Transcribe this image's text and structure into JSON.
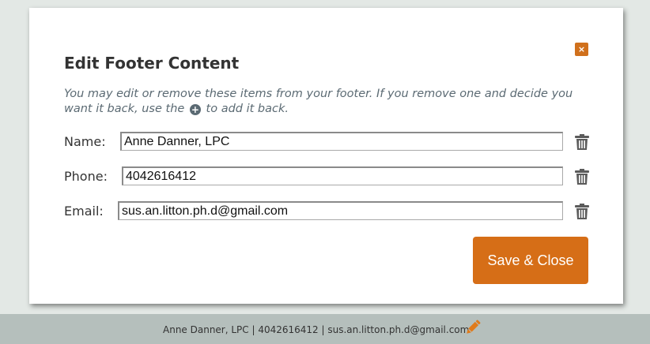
{
  "modal": {
    "title": "Edit Footer Content",
    "description_before": "You may edit or remove these items from your footer. If you remove one and decide you want it back, use the",
    "description_after": "to add it back.",
    "plus_glyph": "+",
    "close_glyph": "×",
    "fields": [
      {
        "label": "Name:",
        "value": "Anne Danner, LPC"
      },
      {
        "label": "Phone:",
        "value": "4042616412"
      },
      {
        "label": "Email:",
        "value": "sus.an.litton.ph.d@gmail.com"
      }
    ],
    "save_label": "Save & Close"
  },
  "footer": {
    "text": "Anne Danner, LPC | 4042616412 | sus.an.litton.ph.d@gmail.com"
  },
  "colors": {
    "accent": "#d66e17",
    "page_bg": "#e3e8e5",
    "footer_bg": "#b5bfbc",
    "icon_gray": "#5b5b5b"
  },
  "icons": [
    "close-icon",
    "plus-icon",
    "trash-icon",
    "pencil-icon"
  ]
}
